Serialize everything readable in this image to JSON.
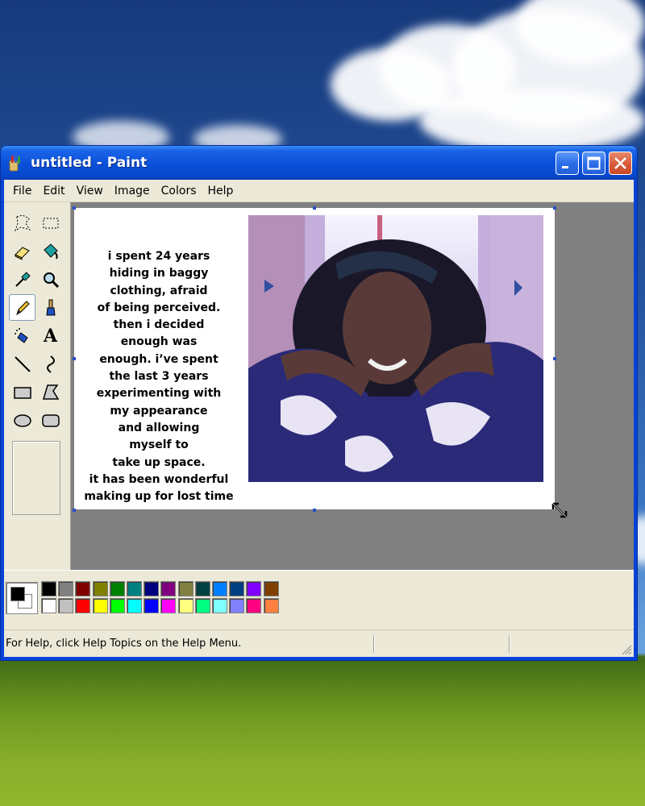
{
  "window": {
    "title": "untitled - Paint",
    "title_buttons": [
      "minimize-button",
      "maximize-button",
      "close-button"
    ]
  },
  "menu": {
    "items": [
      "File",
      "Edit",
      "View",
      "Image",
      "Colors",
      "Help"
    ]
  },
  "tools": [
    {
      "name": "free-form-select-icon"
    },
    {
      "name": "select-icon"
    },
    {
      "name": "eraser-icon"
    },
    {
      "name": "fill-with-color-icon"
    },
    {
      "name": "pick-color-icon"
    },
    {
      "name": "magnifier-icon"
    },
    {
      "name": "pencil-icon",
      "active": true
    },
    {
      "name": "brush-icon"
    },
    {
      "name": "airbrush-icon"
    },
    {
      "name": "text-icon",
      "glyph": "A"
    },
    {
      "name": "line-icon"
    },
    {
      "name": "curve-icon"
    },
    {
      "name": "rectangle-icon"
    },
    {
      "name": "polygon-icon"
    },
    {
      "name": "ellipse-icon"
    },
    {
      "name": "rounded-rectangle-icon"
    }
  ],
  "canvas": {
    "text": "i spent 24 years\nhiding in baggy\nclothing, afraid\nof being perceived.\nthen i decided\nenough was\nenough. i’ve spent\nthe last 3 years\nexperimenting with\nmy appearance\nand allowing\nmyself to\ntake up space.\nit has been wonderful\nmaking up for lost time",
    "photo_description": "photo"
  },
  "palette": {
    "foreground": "#000000",
    "background": "#ffffff",
    "top_row": [
      "#000000",
      "#808080",
      "#800000",
      "#808000",
      "#008000",
      "#008080",
      "#000080",
      "#800080",
      "#808040",
      "#004040",
      "#0080ff",
      "#004080",
      "#8000ff",
      "#804000"
    ],
    "bottom_row": [
      "#ffffff",
      "#c0c0c0",
      "#ff0000",
      "#ffff00",
      "#00ff00",
      "#00ffff",
      "#0000ff",
      "#ff00ff",
      "#ffff80",
      "#00ff80",
      "#80ffff",
      "#8080ff",
      "#ff0080",
      "#ff8040"
    ]
  },
  "status": {
    "help_text": "For Help, click Help Topics on the Help Menu."
  }
}
